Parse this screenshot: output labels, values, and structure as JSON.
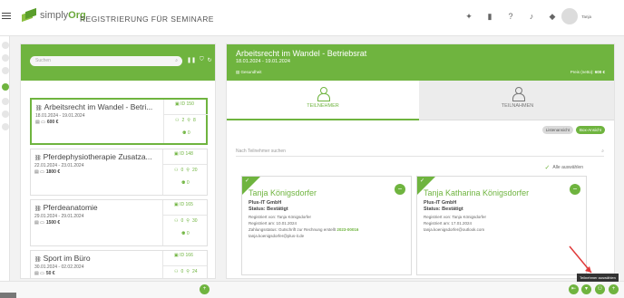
{
  "app": {
    "logo_simply": "simply",
    "logo_org": "Org",
    "page_heading": "REGISTRIERUNG FÜR SEMINARE",
    "user_name": "Tanja"
  },
  "topbar_icons": [
    "lightbulb-icon",
    "book-icon",
    "help-icon",
    "bell-icon",
    "tag-icon"
  ],
  "left": {
    "search_placeholder": "Suchen",
    "seminars": [
      {
        "title": "Arbeitsrecht im Wandel - Betri...",
        "dates": "18.01.2024 - 19.01.2024",
        "price": "600 €",
        "id": "ID 150",
        "c1": "2",
        "c2": "8",
        "c3": "0",
        "selected": true
      },
      {
        "title": "Pferdephysiotherapie Zusatza...",
        "dates": "22.01.2024 - 23.01.2024",
        "price": "1800 €",
        "id": "ID 148",
        "c1": "0",
        "c2": "20",
        "c3": "0",
        "selected": false
      },
      {
        "title": "Pferdeanatomie",
        "dates": "29.01.2024 - 29.01.2024",
        "price": "1500 €",
        "id": "ID 165",
        "c1": "0",
        "c2": "30",
        "c3": "0",
        "selected": false
      },
      {
        "title": "Sport im Büro",
        "dates": "30.01.2024 - 02.02.2024",
        "price": "50 €",
        "id": "ID 166",
        "c1": "0",
        "c2": "24",
        "c3": "",
        "selected": false
      }
    ]
  },
  "right": {
    "title": "Arbeitsrecht im Wandel - Betriebsrat",
    "dates": "18.01.2024 - 19.01.2024",
    "tag": "Gesundheit",
    "price_label": "Preis (netto):",
    "price_value": "600 €",
    "tab_participants": "TEILNEHMER",
    "tab_attendance": "TEILNAHMEN",
    "list_view": "Listenansicht",
    "box_view": "Box-Ansicht",
    "search_placeholder": "Nach Teilnehmer suchen",
    "select_all": "Alle auswählen",
    "participants": [
      {
        "name": "Tanja Königsdorfer",
        "company": "Plus-IT GmbH",
        "status": "Status: Bestätigt",
        "registered_by": "Registriert von: Tanja Königsdorfer",
        "registered_at": "Registriert am: 10.01.2024",
        "payment": "Zahlungsstatus: Gutschrift zur Rechnung erstellt",
        "invoice": "2023-00016",
        "email": "tanja.koenigsdorfer@plus-it.de"
      },
      {
        "name": "Tanja Katharina Königsdorfer",
        "company": "Plus-IT GmbH",
        "status": "Status: Bestätigt",
        "registered_by": "Registriert von: Tanja Königsdorfer",
        "registered_at": "Registriert am: 17.01.2024",
        "payment": "",
        "invoice": "",
        "email": "tanja.koenigsdorfer@outlook.com"
      }
    ]
  },
  "tooltip": "Teilnehmer auswählen",
  "colors": {
    "accent": "#6fb43f",
    "tab_inactive": "#ececec"
  }
}
